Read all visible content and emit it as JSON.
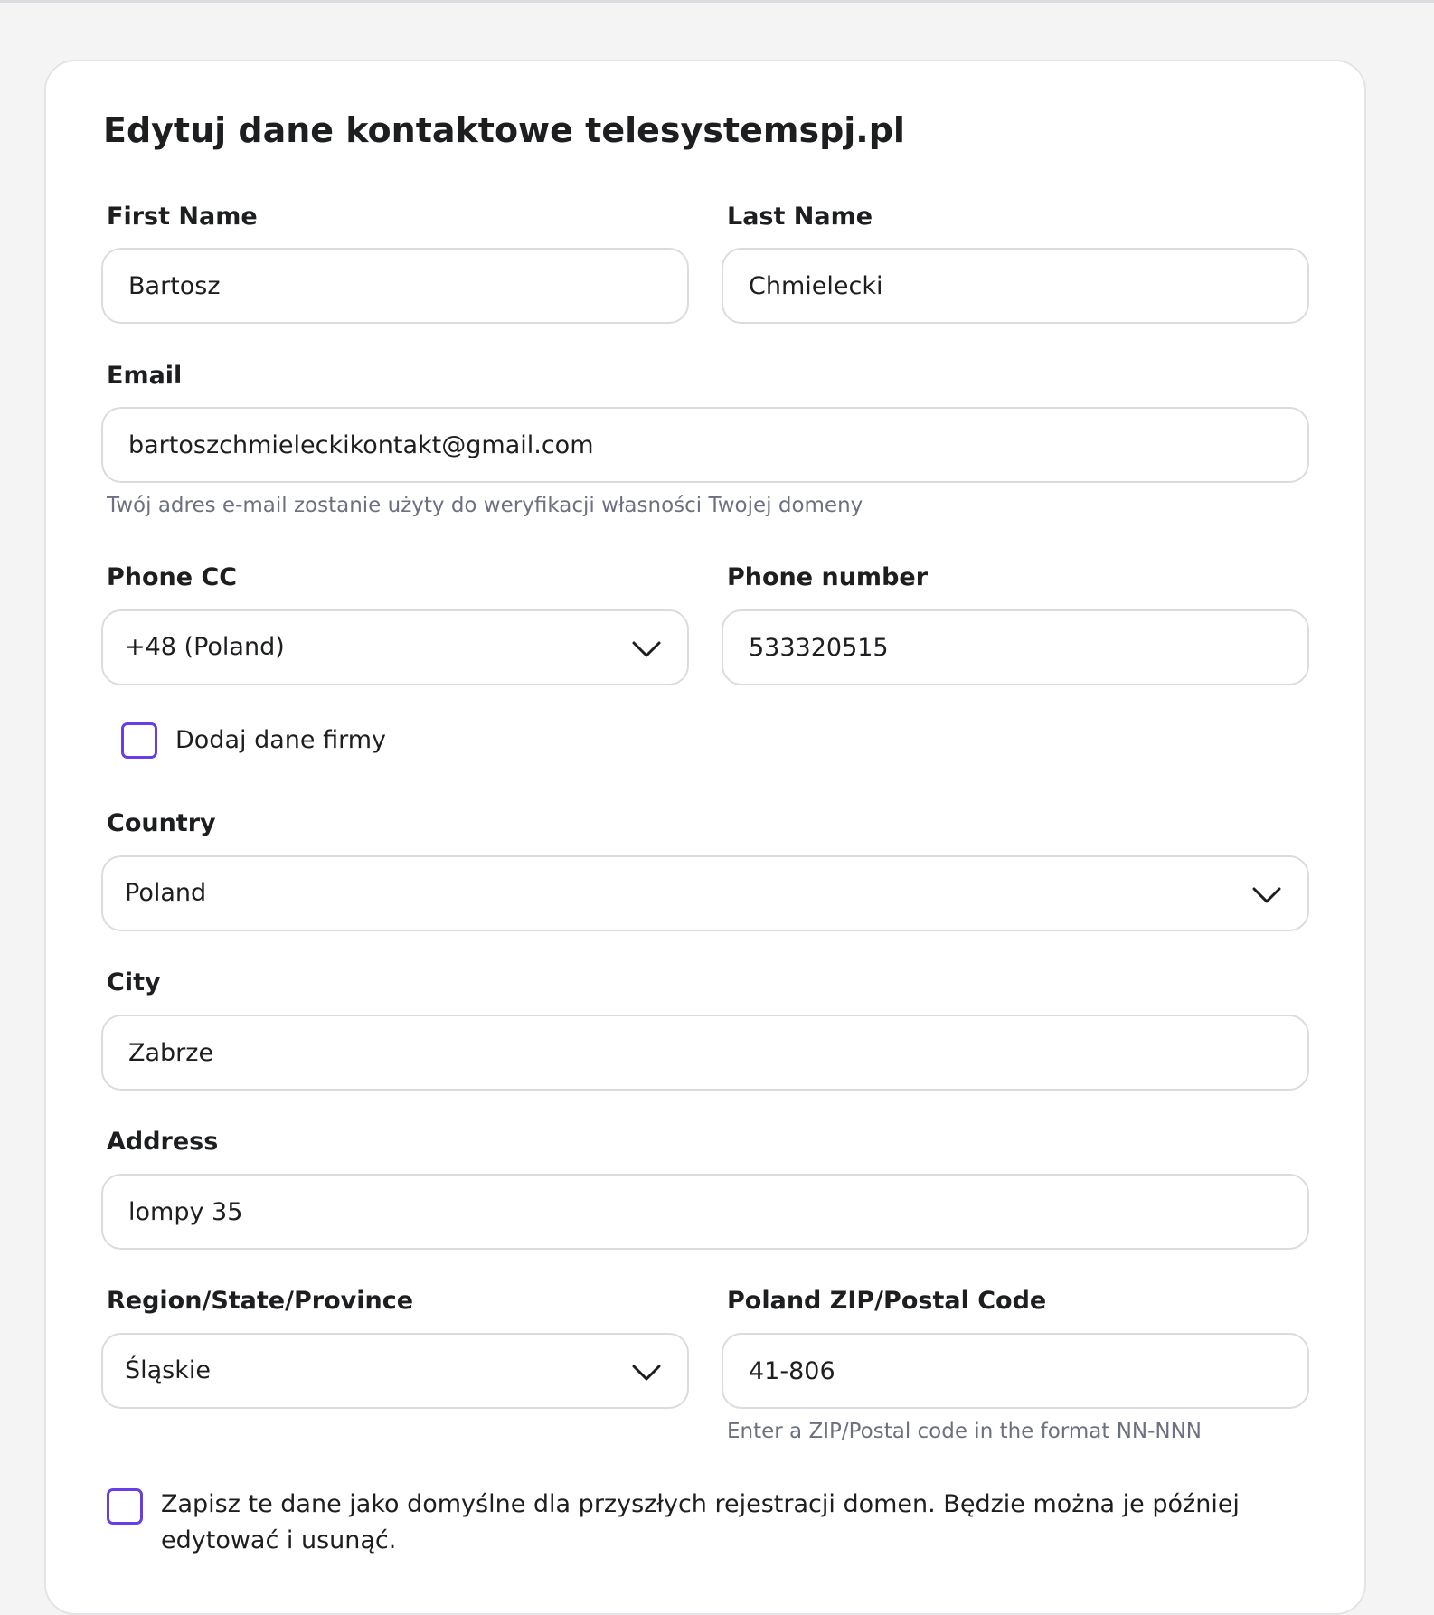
{
  "form": {
    "title": "Edytuj dane kontaktowe telesystemspj.pl",
    "first_name": {
      "label": "First Name",
      "value": "Bartosz"
    },
    "last_name": {
      "label": "Last Name",
      "value": "Chmielecki"
    },
    "email": {
      "label": "Email",
      "value": "bartoszchmieleckikontakt@gmail.com",
      "hint": "Twój adres e-mail zostanie użyty do weryfikacji własności Twojej domeny"
    },
    "phone_cc": {
      "label": "Phone CC",
      "value": "+48 (Poland)",
      "icon": "chevron-down-icon"
    },
    "phone_number": {
      "label": "Phone number",
      "value": "533320515"
    },
    "company_checkbox": {
      "label": "Dodaj dane firmy",
      "checked": false
    },
    "country": {
      "label": "Country",
      "value": "Poland",
      "icon": "chevron-down-icon"
    },
    "city": {
      "label": "City",
      "value": "Zabrze"
    },
    "address": {
      "label": "Address",
      "value": "lompy 35"
    },
    "region": {
      "label": "Region/State/Province",
      "value": "Śląskie",
      "icon": "chevron-down-icon"
    },
    "zip": {
      "label": "Poland ZIP/Postal Code",
      "value": "41-806",
      "hint": "Enter a ZIP/Postal code in the format NN-NNN"
    },
    "default_checkbox": {
      "label": "Zapisz te dane jako domyślne dla przyszłych rejestracji domen. Będzie można je później edytować i usunąć.",
      "checked": false
    }
  },
  "colors": {
    "accent": "#673de6",
    "border": "#dadce0",
    "text": "#1d1e20",
    "muted": "#6d7081",
    "background": "#f4f4f4"
  }
}
